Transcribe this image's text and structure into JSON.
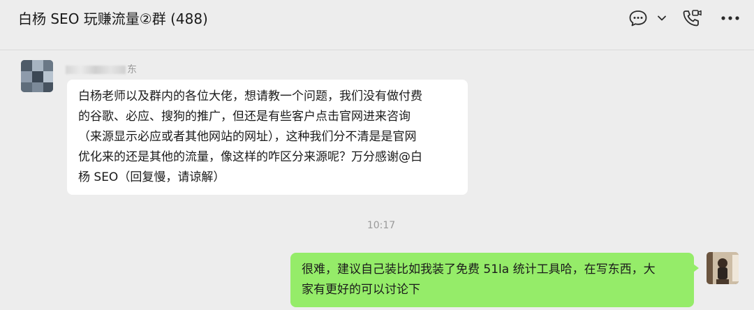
{
  "header": {
    "title": "白杨 SEO 玩赚流量②群 (488)",
    "icons": [
      "chat-bubble-icon",
      "chevron-down-icon",
      "phone-video-icon",
      "more-icon"
    ]
  },
  "messages": [
    {
      "side": "left",
      "sender_visible": "东",
      "text": "白杨老师以及群内的各位大佬，想请教一个问题，我们没有做付费\n的谷歌、必应、搜狗的推广，但还是有些客户点击官网进来咨询\n（来源显示必应或者其他网站的网址），这种我们分不清是是官网\n优化来的还是其他的流量，像这样的咋区分来源呢？万分感谢@白\n杨 SEO（回复慢，请谅解）"
    },
    {
      "side": "right",
      "text": "很难，建议自己装比如我装了免费 51la 统计工具哈，在写东西，大\n家有更好的可以讨论下"
    }
  ],
  "timestamp": "10:17",
  "colors": {
    "background": "#ededed",
    "incoming_bubble": "#ffffff",
    "outgoing_bubble": "#95ec69",
    "muted_text": "#9a9a9a"
  }
}
